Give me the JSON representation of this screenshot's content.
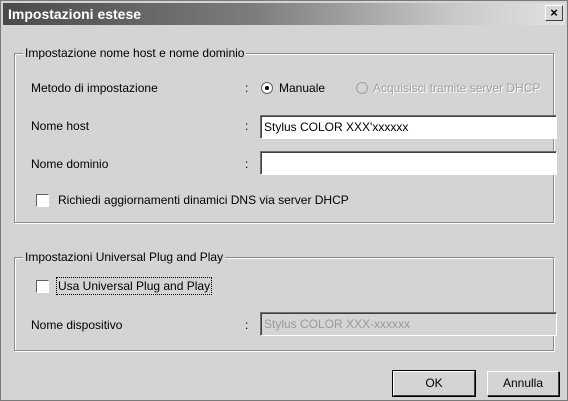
{
  "window": {
    "title": "Impostazioni estese",
    "close_label": "×"
  },
  "host_group": {
    "title": "Impostazione nome host e nome dominio",
    "method_label": "Metodo di impostazione",
    "method_options": [
      {
        "label": "Manuale",
        "selected": true,
        "enabled": true
      },
      {
        "label": "Acquisisci tramite server DHCP",
        "selected": false,
        "enabled": false
      }
    ],
    "host_label": "Nome host",
    "host_value": "Stylus COLOR XXX'xxxxxx",
    "domain_label": "Nome dominio",
    "domain_value": "",
    "dns_checkbox_label": "Richiedi aggiornamenti dinamici DNS via server DHCP",
    "dns_checked": false
  },
  "upnp_group": {
    "title": "Impostazioni Universal Plug and Play",
    "use_checkbox_label": "Usa Universal Plug and Play",
    "use_checked": false,
    "device_label": "Nome dispositivo",
    "device_value": "Stylus COLOR XXX-xxxxxx"
  },
  "colon": ":",
  "buttons": {
    "ok": "OK",
    "cancel": "Annulla"
  }
}
